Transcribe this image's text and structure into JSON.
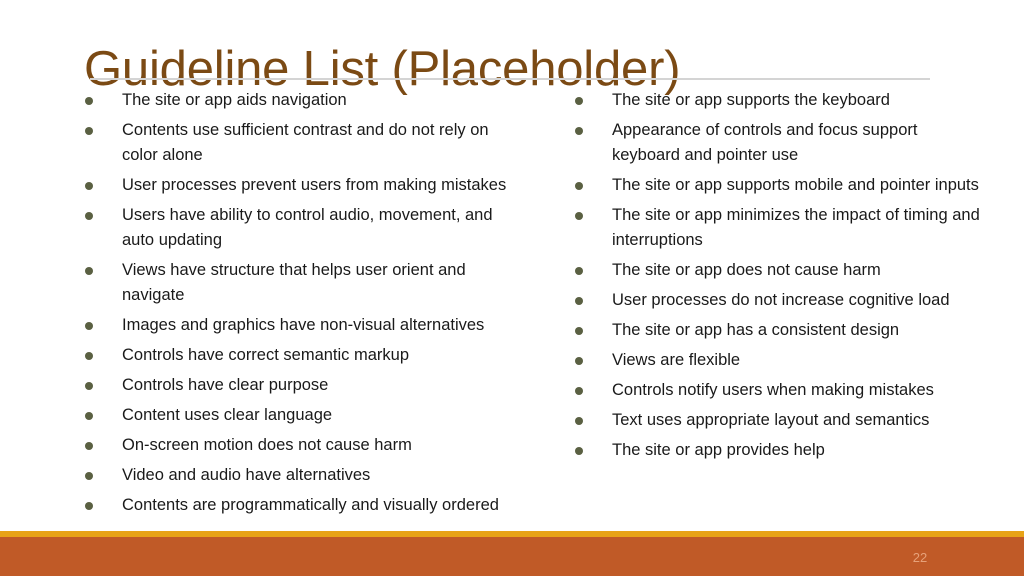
{
  "slide": {
    "title": "Guideline List (Placeholder)",
    "page_number": "22"
  },
  "colors": {
    "title": "#7b4a14",
    "body_text": "#1a1a1a",
    "bullet": "#5a6042",
    "rule": "#d4d4d4",
    "footer_gold": "#e8a317",
    "footer_orange": "#c05a27",
    "page_number": "#e6a179",
    "background": "#ffffff"
  },
  "columns": {
    "left": {
      "items": [
        "The site or app aids navigation",
        "Contents use sufficient contrast and do not rely on color alone",
        "User processes prevent users from making mistakes",
        "Users have ability to control audio, movement, and auto updating",
        "Views have structure that helps user orient and navigate",
        "Images and graphics have non-visual alternatives",
        "Controls have correct semantic markup",
        "Controls have clear purpose",
        "Content uses clear language",
        "On-screen motion does not cause harm",
        "Video and audio have alternatives",
        "Contents are programmatically and visually ordered"
      ]
    },
    "right": {
      "items": [
        "The site or app supports the keyboard",
        "Appearance of controls and focus support keyboard and pointer use",
        "The site or app supports mobile and pointer inputs",
        "The site or app minimizes the impact of timing and interruptions",
        "The site or app does not cause harm",
        "User processes do not increase cognitive load",
        "The site or app has a consistent design",
        "Views are flexible",
        "Controls notify users when making mistakes",
        "Text uses appropriate layout and semantics",
        "The site or app provides help"
      ]
    }
  }
}
